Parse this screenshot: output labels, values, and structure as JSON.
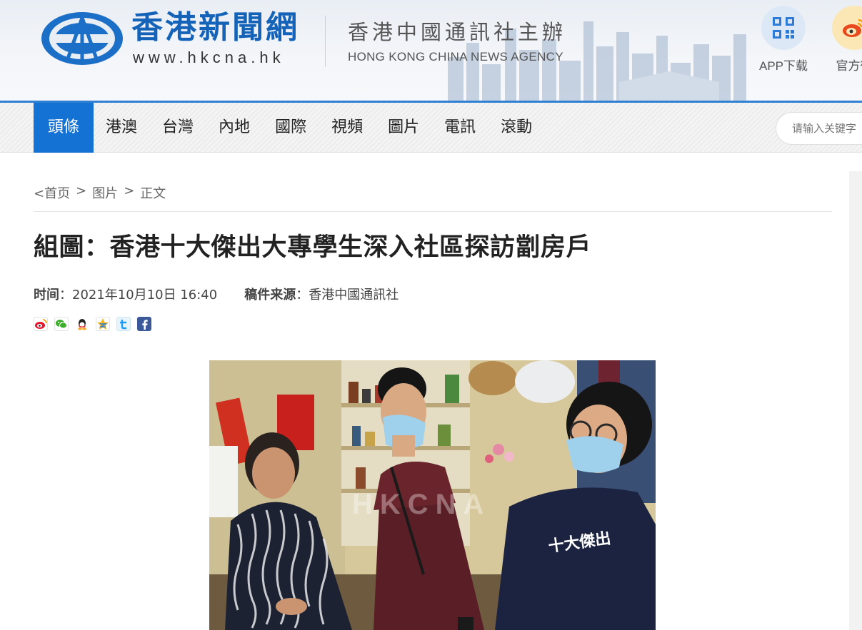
{
  "header": {
    "logo_cn": "香港新聞網",
    "logo_url": "www.hkcna.hk",
    "agency_cn": "香港中國通訊社主辦",
    "agency_en": "HONG KONG CHINA NEWS AGENCY",
    "app_label": "APP下载",
    "weibo_label": "官方微",
    "app_icon": "qr-code-icon",
    "weibo_icon": "weibo-icon"
  },
  "nav": {
    "items": [
      {
        "label": "頭條",
        "active": true
      },
      {
        "label": "港澳"
      },
      {
        "label": "台灣"
      },
      {
        "label": "內地"
      },
      {
        "label": "國際"
      },
      {
        "label": "視頻"
      },
      {
        "label": "圖片"
      },
      {
        "label": "電訊"
      },
      {
        "label": "滾動"
      }
    ],
    "search_placeholder": "请输入关键字"
  },
  "breadcrumb": {
    "home": "<首页",
    "section": "图片",
    "current": "正文",
    "sep": ">"
  },
  "article": {
    "title": "組圖：香港十大傑出大專學生深入社區探訪劏房戶",
    "time_label": "时间",
    "time_value": "2021年10月10日 16:40",
    "source_label": "稿件来源",
    "source_value": "香港中國通訊社",
    "colon": "："
  },
  "share": [
    "weibo-share-icon",
    "wechat-share-icon",
    "qq-share-icon",
    "qzone-share-icon",
    "tencent-weibo-share-icon",
    "facebook-share-icon"
  ],
  "photo": {
    "watermark": "HKCNA",
    "shirt_text": "十大傑出"
  },
  "colors": {
    "brand_blue": "#1463b8",
    "nav_active": "#1372d4",
    "header_line": "#2f7fd3"
  }
}
